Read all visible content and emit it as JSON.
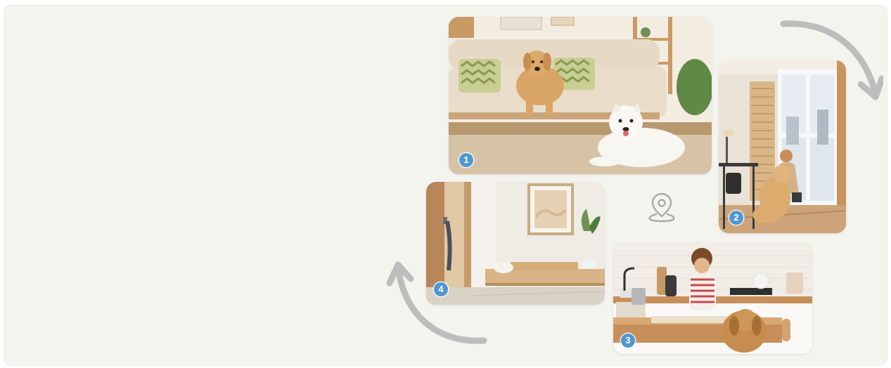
{
  "scenes": [
    {
      "id": "living-room",
      "badge": "1",
      "description_icon": "dogs-on-sofa-photo"
    },
    {
      "id": "window-room",
      "badge": "2",
      "description_icon": "woman-with-dog-photo"
    },
    {
      "id": "kitchen",
      "badge": "3",
      "description_icon": "child-and-dog-kitchen-photo"
    },
    {
      "id": "hallway",
      "badge": "4",
      "description_icon": "hallway-photo"
    }
  ],
  "icons": {
    "location": "location-pin-icon",
    "arrow_top": "curved-arrow-icon",
    "arrow_bottom": "curved-arrow-icon"
  },
  "colors": {
    "background": "#f4f4ef",
    "badge": "#4f97d3",
    "arrow": "#bdbdbd"
  }
}
